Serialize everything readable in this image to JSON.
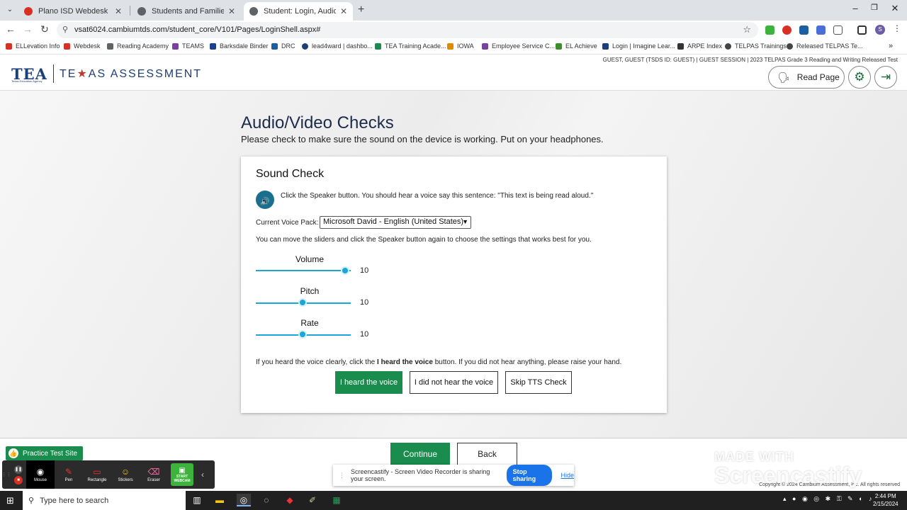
{
  "browser": {
    "tabs": [
      {
        "title": "Plano ISD Webdesk",
        "color": "#d93025"
      },
      {
        "title": "Students and Families",
        "color": "#5f6368"
      },
      {
        "title": "Student: Login, Audio/Video Ch",
        "color": "#5f6368"
      }
    ],
    "url": "vsat6024.cambiumtds.com/student_core/V101/Pages/LoginShell.aspx#",
    "bookmarks": [
      {
        "label": "ELLevation Info",
        "color": "#d93025"
      },
      {
        "label": "Webdesk",
        "color": "#d93025"
      },
      {
        "label": "Reading Academy",
        "color": "#5f6368"
      },
      {
        "label": "TEAMS",
        "color": "#7b3fa0"
      },
      {
        "label": "Barksdale Binder",
        "color": "#1a3f8f"
      },
      {
        "label": "DRC",
        "color": "#1a5fa0"
      },
      {
        "label": "lead4ward | dashbo...",
        "color": "#1c3f77"
      },
      {
        "label": "TEA Training Acade...",
        "color": "#1a8c4e"
      },
      {
        "label": "IOWA",
        "color": "#e08a00"
      },
      {
        "label": "Employee Service C...",
        "color": "#7b3fa0"
      },
      {
        "label": "EL Achieve",
        "color": "#3d8c2e"
      },
      {
        "label": "Login | Imagine Lear...",
        "color": "#1c3f77"
      },
      {
        "label": "ARPE Index",
        "color": "#333333"
      },
      {
        "label": "TELPAS Trainings",
        "color": "#444444"
      },
      {
        "label": "Released TELPAS Te...",
        "color": "#444444"
      }
    ]
  },
  "header": {
    "session_text": "GUEST, GUEST (TSDS ID: GUEST) | GUEST SESSION | 2023 TELPAS Grade 3 Reading and Writing Released Test",
    "tea_logo": "TEA",
    "tea_sub": "Texas Education Agency",
    "brand_left": "TE",
    "brand_star": "★",
    "brand_right": "AS",
    "brand_word": "ASSESSMENT",
    "read_page_label": "Read Page"
  },
  "page": {
    "title": "Audio/Video Checks",
    "subtitle": "Please check to make sure the sound on the device is working. Put on your headphones."
  },
  "sound_check": {
    "heading": "Sound Check",
    "instruction": "Click the Speaker button. You should hear a voice say this sentence: \"This text is being read aloud.\"",
    "voice_pack_label": "Current Voice Pack:",
    "voice_pack_value": "Microsoft David - English (United States)",
    "move_instruction": "You can move the sliders and click the Speaker button again to choose the settings that works best for you.",
    "sliders": [
      {
        "label": "Volume",
        "value": "10",
        "fraction": 1.0
      },
      {
        "label": "Pitch",
        "value": "10",
        "fraction": 0.5
      },
      {
        "label": "Rate",
        "value": "10",
        "fraction": 0.5
      }
    ],
    "heard_pre": "If you heard the voice clearly, click the ",
    "heard_bold": "I heard the voice",
    "heard_post": " button. If you did not hear anything, please raise your hand.",
    "buttons": {
      "heard": "I heard the voice",
      "not_heard": "I did not hear the voice",
      "skip": "Skip TTS Check"
    }
  },
  "footer": {
    "practice": "Practice Test Site",
    "continue": "Continue",
    "back": "Back",
    "copyright": "Copyright © 2024 Cambium Assessment, Inc. All rights reserved"
  },
  "screencastify": {
    "tools": [
      {
        "label": "Mouse",
        "icon": "◉"
      },
      {
        "label": "Pen",
        "icon": "✎"
      },
      {
        "label": "Rectangle",
        "icon": "▭"
      },
      {
        "label": "Stickers",
        "icon": "☺"
      },
      {
        "label": "Eraser",
        "icon": "⌫"
      }
    ],
    "webcam": "START WEBCAM",
    "share_text": "Screencastify - Screen Video Recorder is sharing your screen.",
    "stop_sharing": "Stop sharing",
    "hide": "Hide",
    "watermark_made": "MADE WITH",
    "watermark_brand": "Screencastify"
  },
  "taskbar": {
    "search_placeholder": "Type here to search",
    "time": "2:44 PM",
    "date": "2/15/2024"
  },
  "colors": {
    "accent_green": "#1a8c4e",
    "slider_blue": "#1aa6d6",
    "tea_blue": "#1c3f77"
  }
}
